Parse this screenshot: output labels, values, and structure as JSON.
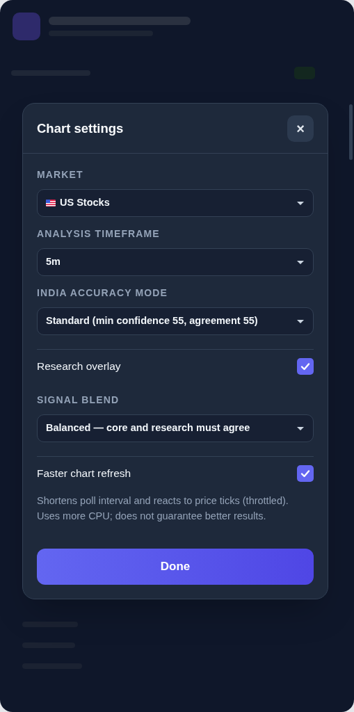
{
  "modal": {
    "title": "Chart settings",
    "close": "×",
    "fields": [
      {
        "kind": "select",
        "label": "MARKET",
        "value": "US Stocks",
        "flag": true
      },
      {
        "kind": "select",
        "label": "ANALYSIS TIMEFRAME",
        "value": "5m",
        "flag": false
      },
      {
        "kind": "select",
        "label": "INDIA ACCURACY MODE",
        "value": "Standard (min confidence 55, agreement 55)",
        "flag": false
      },
      {
        "kind": "checkbox",
        "label": "Research overlay",
        "checked": true
      },
      {
        "kind": "select",
        "label": "SIGNAL BLEND",
        "value": "Balanced — core and research must agree",
        "flag": false
      },
      {
        "kind": "checkbox",
        "label": "Faster chart refresh",
        "checked": true,
        "note": "Shortens poll interval and reacts to price ticks (throttled). Uses more CPU; does not guarantee better results."
      }
    ],
    "done": "Done"
  }
}
